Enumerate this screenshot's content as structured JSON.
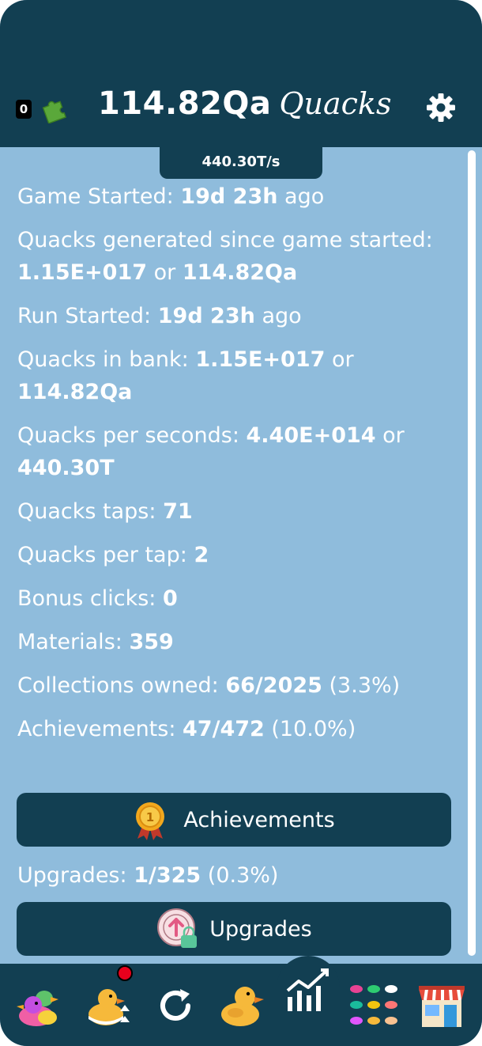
{
  "header": {
    "puzzle_count": "0",
    "quacks_amount": "114.82Qa",
    "quacks_unit": "Quacks",
    "rate": "440.30T/s"
  },
  "stats": [
    {
      "label": "Game Started: ",
      "value": "19d 23h",
      "suffix": " ago"
    },
    {
      "label": "Quacks generated since game started: ",
      "value": "1.15E+017",
      "mid": " or ",
      "value2": "114.82Qa"
    },
    {
      "label": "Run Started: ",
      "value": "19d 23h",
      "suffix": " ago"
    },
    {
      "label": "Quacks in bank: ",
      "value": "1.15E+017",
      "mid": " or ",
      "value2": "114.82Qa"
    },
    {
      "label": "Quacks per seconds: ",
      "value": "4.40E+014",
      "mid": " or ",
      "value2": "440.30T"
    },
    {
      "label": "Quacks taps: ",
      "value": "71"
    },
    {
      "label": "Quacks per tap: ",
      "value": "2"
    },
    {
      "label": "Bonus clicks: ",
      "value": "0"
    },
    {
      "label": "Materials: ",
      "value": "359"
    },
    {
      "label": "Collections owned: ",
      "value": "66/2025",
      "suffix": " (3.3%)"
    },
    {
      "label": "Achievements: ",
      "value": "47/472",
      "suffix": " (10.0%)"
    }
  ],
  "achievements_button": {
    "label": "Achievements"
  },
  "upgrades_stat": {
    "label": "Upgrades: ",
    "value": "1/325",
    "suffix": " (0.3%)"
  },
  "upgrades_button": {
    "label": "Upgrades"
  },
  "navbar": {
    "items": [
      "collection-ducks-icon",
      "duck-upgrade-icon",
      "reset-icon",
      "duck-icon",
      "stats-chart-icon",
      "duck-grid-icon",
      "shop-icon"
    ],
    "active": "stats-chart-icon"
  },
  "colors": {
    "header": "#123f52",
    "panel": "#8fbcdc",
    "notification": "#e8001c"
  }
}
